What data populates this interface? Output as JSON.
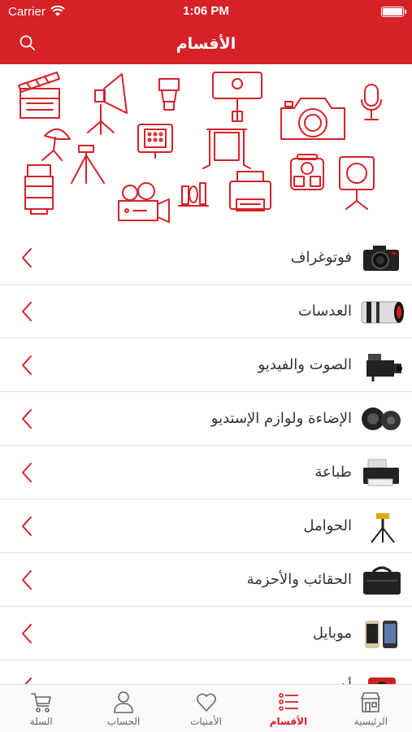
{
  "status_bar": {
    "carrier": "Carrier",
    "time": "1:06 PM",
    "battery_level": 1.0
  },
  "nav": {
    "title": "الأقسام",
    "search_icon": "search-icon"
  },
  "banner": {
    "icons": [
      "clapperboard",
      "studio-spotlight",
      "camera-flash",
      "phone-selfie",
      "dslr-camera",
      "microphone",
      "umbrella-light",
      "tripod",
      "led-panel",
      "backdrop-stand",
      "camera-backpack",
      "fresnel-light",
      "lens",
      "video-camera",
      "cleaning-kit",
      "printer"
    ]
  },
  "categories": [
    {
      "label": "فوتوغراف",
      "thumb": "camera-thumb"
    },
    {
      "label": "العدسات",
      "thumb": "lens-thumb"
    },
    {
      "label": "الصوت والفيديو",
      "thumb": "camcorder-thumb"
    },
    {
      "label": "الإضاءة ولوازم الإستديو",
      "thumb": "studio-light-thumb"
    },
    {
      "label": "طباعة",
      "thumb": "printer-thumb"
    },
    {
      "label": "الحوامل",
      "thumb": "tripod-thumb"
    },
    {
      "label": "الحقائب والأحزمة",
      "thumb": "bag-thumb"
    },
    {
      "label": "موبايل",
      "thumb": "phone-thumb"
    },
    {
      "label": "أخرى",
      "thumb": "other-thumb"
    }
  ],
  "tabbar": {
    "tabs": [
      {
        "label": "السلة",
        "icon": "cart-icon"
      },
      {
        "label": "الحساب",
        "icon": "user-icon"
      },
      {
        "label": "الأمنيات",
        "icon": "heart-icon"
      },
      {
        "label": "الأقسام",
        "icon": "list-icon",
        "active": true
      },
      {
        "label": "الرئيسية",
        "icon": "store-icon"
      }
    ]
  },
  "colors": {
    "brand": "#d62127",
    "text": "#333333",
    "divider": "#e4e4e4"
  }
}
